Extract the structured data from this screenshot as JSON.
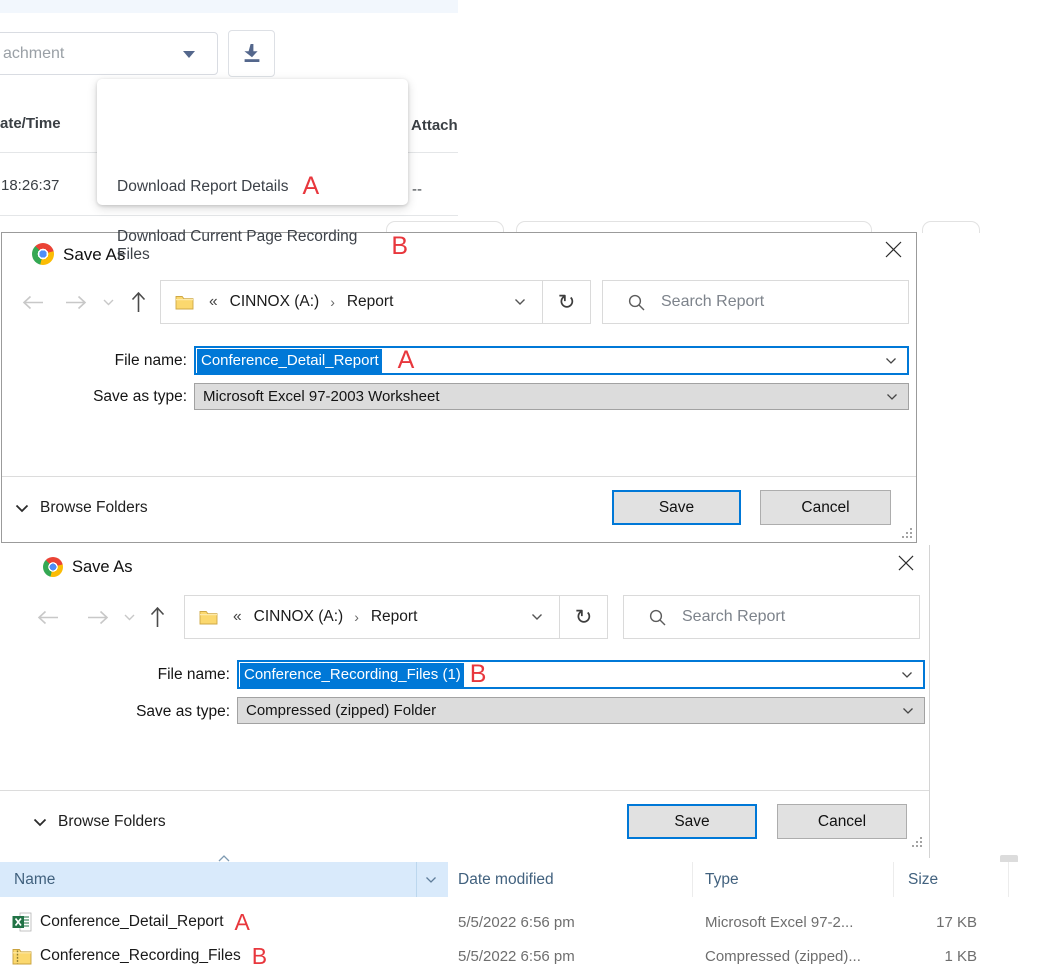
{
  "colors": {
    "accent_blue": "#0078d7",
    "annotation_red": "#e8373d",
    "name_header_bg": "#d9eafb",
    "slate_icon": "#54678c"
  },
  "app_background": {
    "attachment_select_value": "achment",
    "table_header_datetime": "ate/Time",
    "table_header_attach": "Attach",
    "row_time": "18:26:37",
    "row_attach_value": "--",
    "menu_items": [
      {
        "label": "Download Report Details",
        "annotation": "A"
      },
      {
        "label": "Download Current Page Recording Files",
        "annotation": "B"
      }
    ]
  },
  "save_dialog_a": {
    "title": "Save As",
    "breadcrumb_prefix": "«",
    "breadcrumb_drive": "CINNOX (A:)",
    "breadcrumb_separator": "›",
    "breadcrumb_folder": "Report",
    "refresh_glyph": "↻",
    "search_placeholder": "Search Report",
    "file_name_label": "File name:",
    "file_name_value": "Conference_Detail_Report",
    "annotation": "A",
    "save_as_type_label": "Save as type:",
    "save_as_type_value": "Microsoft Excel 97-2003 Worksheet",
    "browse_folders_label": "Browse Folders",
    "save_button": "Save",
    "cancel_button": "Cancel"
  },
  "save_dialog_b": {
    "title": "Save As",
    "breadcrumb_prefix": "«",
    "breadcrumb_drive": "CINNOX (A:)",
    "breadcrumb_separator": "›",
    "breadcrumb_folder": "Report",
    "refresh_glyph": "↻",
    "search_placeholder": "Search Report",
    "file_name_label": "File name:",
    "file_name_value": "Conference_Recording_Files (1)",
    "annotation": "B",
    "save_as_type_label": "Save as type:",
    "save_as_type_value": "Compressed (zipped) Folder",
    "browse_folders_label": "Browse Folders",
    "save_button": "Save",
    "cancel_button": "Cancel"
  },
  "file_explorer": {
    "columns": [
      {
        "label": "Name"
      },
      {
        "label": "Date modified"
      },
      {
        "label": "Type"
      },
      {
        "label": "Size"
      }
    ],
    "rows": [
      {
        "name": "Conference_Detail_Report",
        "annotation": "A",
        "date_modified": "5/5/2022 6:56 pm",
        "type": "Microsoft Excel 97-2...",
        "size": "17 KB"
      },
      {
        "name": "Conference_Recording_Files",
        "annotation": "B",
        "date_modified": "5/5/2022 6:56 pm",
        "type": "Compressed (zipped)...",
        "size": "1 KB"
      }
    ]
  }
}
